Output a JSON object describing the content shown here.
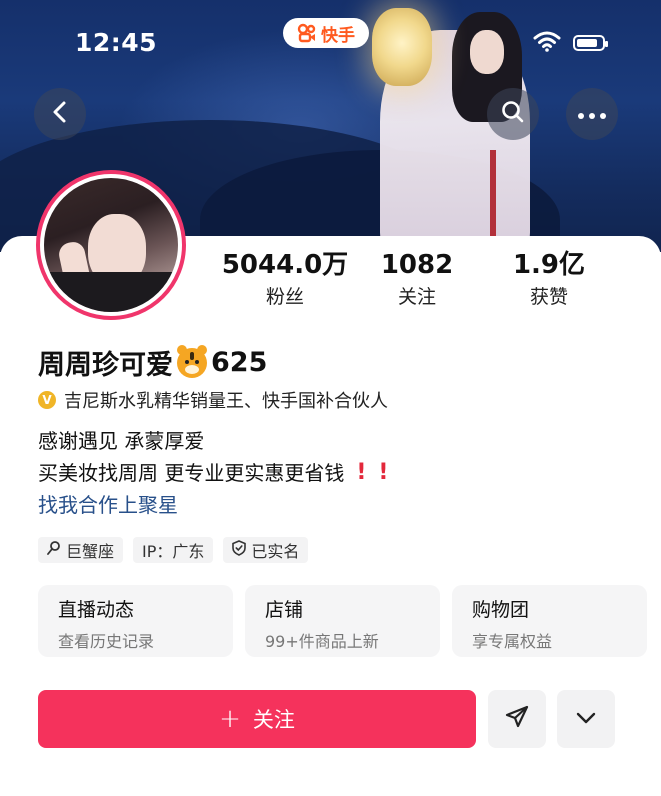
{
  "status_bar": {
    "time": "12:45"
  },
  "brand": {
    "name": "快手",
    "color": "#ff5a1f"
  },
  "header": {
    "back_icon": "chevron-left-icon",
    "search_icon": "search-icon",
    "more_icon": "more-horizontal-icon"
  },
  "profile": {
    "name": "周周珍可爱",
    "name_emoji": "tiger-face-icon",
    "name_suffix": "625",
    "verified_text": "吉尼斯水乳精华销量王、快手国补合伙人",
    "bio_lines": [
      "感谢遇见 承蒙厚爱",
      "买美妆找周周 更专业更实惠更省钱"
    ],
    "bio_marks": [
      "!",
      "!"
    ],
    "link_text": "找我合作上聚星"
  },
  "stats": [
    {
      "value": "5044.0万",
      "label": "粉丝"
    },
    {
      "value": "1082",
      "label": "关注"
    },
    {
      "value": "1.9亿",
      "label": "获赞"
    }
  ],
  "tags": [
    {
      "icon": "pin-icon",
      "label": "巨蟹座"
    },
    {
      "icon": "",
      "label": "IP：广东"
    },
    {
      "icon": "shield-check-icon",
      "label": "已实名"
    }
  ],
  "entry_cards": [
    {
      "title": "直播动态",
      "subtitle": "查看历史记录"
    },
    {
      "title": "店铺",
      "subtitle": "99+件商品上新"
    },
    {
      "title": "购物团",
      "subtitle": "享专属权益"
    }
  ],
  "actions": {
    "follow_plus": "+",
    "follow_label": "关注",
    "follow_color": "#f5325c",
    "share_icon": "send-icon",
    "expand_icon": "chevron-down-icon"
  }
}
